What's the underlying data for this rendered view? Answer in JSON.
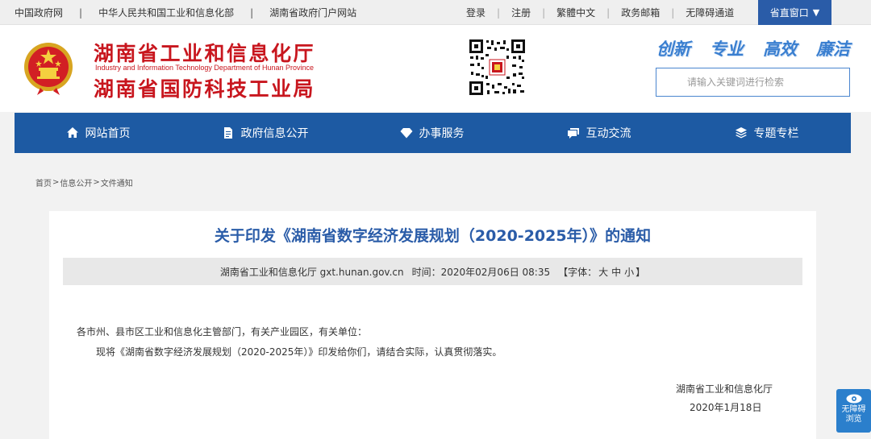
{
  "topbar": {
    "left_links": [
      "中国政府网",
      "中华人民共和国工业和信息化部",
      "湖南省政府门户网站"
    ],
    "separator": "|",
    "login": "登录",
    "register": "注册",
    "traditional": "繁體中文",
    "mail": "政务邮箱",
    "accessible": "无障碍通道",
    "dept_button": "省直窗口",
    "dept_arrow": "▼"
  },
  "header": {
    "title_line1": "湖南省工业和信息化厅",
    "title_en": "Industry and Information Technology Department of Hunan Province",
    "title_line2": "湖南省国防科技工业局",
    "slogan": [
      "创新",
      "专业",
      "高效",
      "廉洁"
    ],
    "search_placeholder": "请输入关键词进行检索"
  },
  "nav": {
    "items": [
      {
        "label": "网站首页",
        "icon": "home-icon"
      },
      {
        "label": "政府信息公开",
        "icon": "document-icon"
      },
      {
        "label": "办事服务",
        "icon": "diamond-icon"
      },
      {
        "label": "互动交流",
        "icon": "chat-icon"
      },
      {
        "label": "专题专栏",
        "icon": "layers-icon"
      }
    ]
  },
  "breadcrumb": {
    "home": "首页",
    "info": "信息公开",
    "current": "文件通知",
    "separator": ">"
  },
  "article": {
    "title": "关于印发《湖南省数字经济发展规划（2020-2025年）》的通知",
    "source": "湖南省工业和信息化厅 gxt.hunan.gov.cn",
    "time_label": "时间：",
    "time_value": "2020年02月06日 08:35",
    "font_label_open": "【字体：",
    "font_large": "大",
    "font_medium": "中",
    "font_small": "小",
    "font_label_close": "】",
    "para1": "各市州、县市区工业和信息化主管部门，有关产业园区，有关单位：",
    "para2": "现将《湖南省数字经济发展规划（2020-2025年）》印发给你们，请结合实际，认真贯彻落实。",
    "sign_org": "湖南省工业和信息化厅",
    "sign_date": "2020年1月18日"
  },
  "access_float": {
    "line1": "无障碍",
    "line2": "浏览"
  },
  "colors": {
    "brand_red": "#c8161e",
    "nav_blue": "#1d5aa3",
    "title_blue": "#2a5ca8",
    "slogan_blue": "#3a7fd0"
  }
}
